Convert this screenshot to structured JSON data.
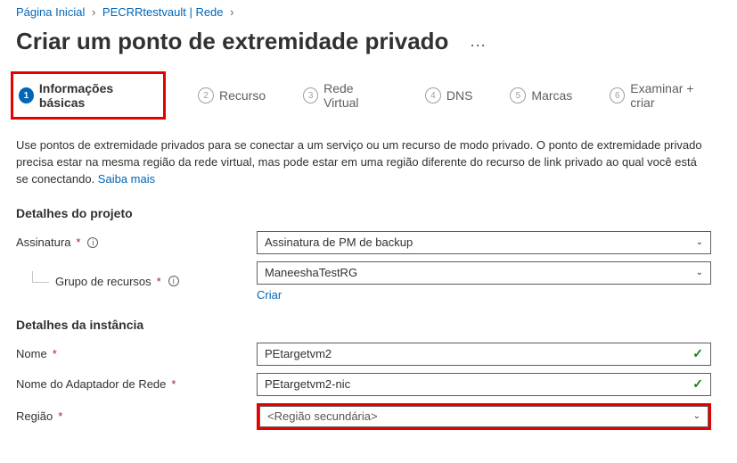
{
  "breadcrumb": {
    "home": "Página Inicial",
    "vault": "PECRRtestvault | Rede"
  },
  "page": {
    "title": "Criar um ponto de extremidade privado"
  },
  "tabs": {
    "t1": "Informações básicas",
    "t2": "Recurso",
    "t3": "Rede Virtual",
    "t4": "DNS",
    "t5": "Marcas",
    "t6": "Examinar + criar"
  },
  "intro": {
    "text": "Use pontos de extremidade privados para se conectar a um serviço ou um recurso de modo privado. O ponto de extremidade privado precisa estar na mesma região da rede virtual, mas pode estar em uma região diferente do recurso de link privado ao qual você está se conectando. ",
    "link": "Saiba mais"
  },
  "sections": {
    "project": "Detalhes do projeto",
    "instance": "Detalhes da instância"
  },
  "labels": {
    "subscription": "Assinatura",
    "resourceGroup": "Grupo de recursos",
    "name": "Nome",
    "nicName": "Nome do Adaptador de Rede",
    "region": "Região"
  },
  "values": {
    "subscription": "Assinatura de PM de backup",
    "resourceGroup": "ManeeshaTestRG",
    "createNew": "Criar",
    "name": "PEtargetvm2",
    "nicName": "PEtargetvm2-nic",
    "region": "<Região secundária>"
  }
}
